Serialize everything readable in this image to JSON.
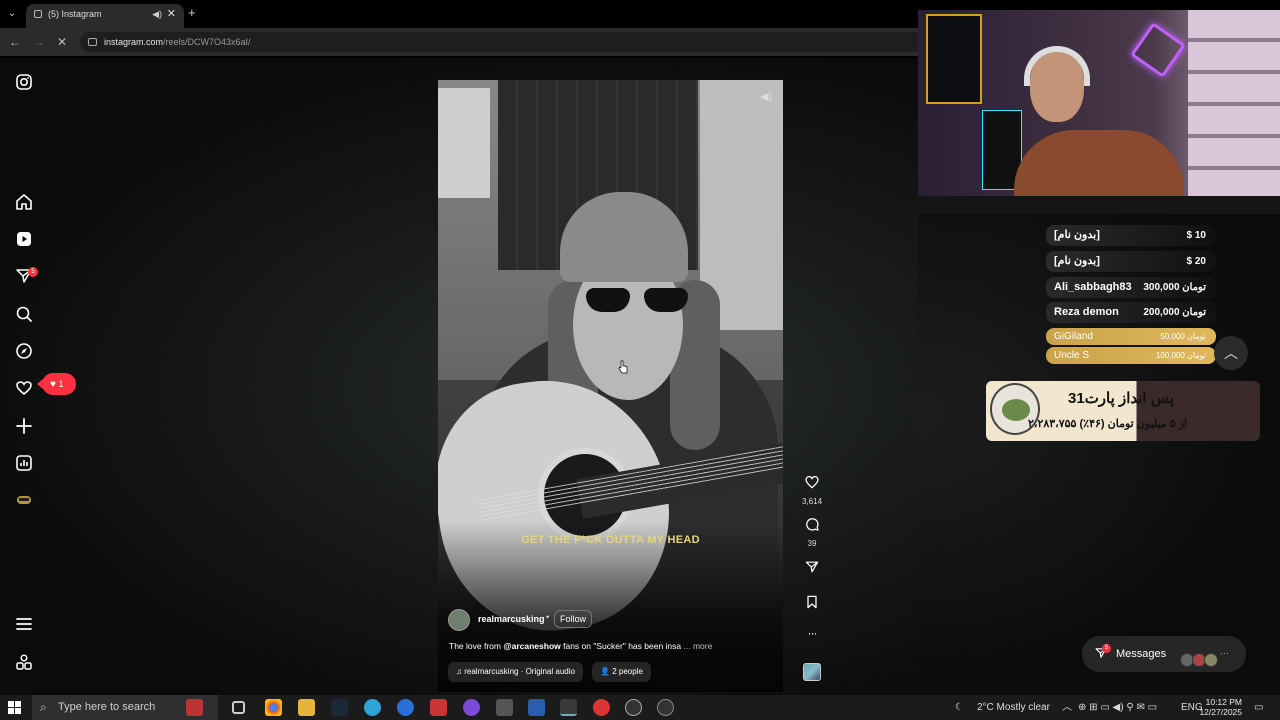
{
  "browser": {
    "tab_title": "(5) Instagram",
    "tab_close": "✕",
    "new_tab": "+",
    "url_site": "instagram.com",
    "url_path": "/reels/DCW7O43x6aI/"
  },
  "sidebar": {
    "notification_count": "5",
    "like_count": "1"
  },
  "reel": {
    "caption_overlay": "GET THE F*CK OUTTA MY HEAD",
    "author": "realmarcusking",
    "separator": "•",
    "follow_label": "Follow",
    "description_pre": "The love from ",
    "description_mention": "@arcaneshow",
    "description_post": " fans on \"Sucker\" has been insa",
    "description_more": "... more",
    "audio_label": "realmarcusking · Original audio",
    "people_label": "2 people",
    "likes": "3,614",
    "comments": "39"
  },
  "donations": [
    {
      "name": "[بدون نام]",
      "amount": "$ 10"
    },
    {
      "name": "[بدون نام]",
      "amount": "$ 20"
    },
    {
      "name": "Ali_sabbagh83",
      "amount": "300,000 تومان"
    },
    {
      "name": "Reza demon",
      "amount": "200,000 تومان"
    },
    {
      "name": "GiGiland",
      "amount": "50,000 تومان"
    },
    {
      "name": "Uncle S",
      "amount": "100,000 تومان"
    }
  ],
  "goal": {
    "title": "پس انداز پارت31",
    "progress_text": "۲،۲۸۳،۷۵۵ از ۵ میلیون تومان (۴۶٪)"
  },
  "messages": {
    "label": "Messages",
    "badge": "5"
  },
  "taskbar": {
    "search_placeholder": "Type here to search",
    "weather": "2°C  Mostly clear",
    "lang": "ENG",
    "time": "10:12 PM",
    "date": "12/27/2025"
  },
  "colors": {
    "instagram_red": "#ff3040",
    "caption_yellow": "#e6d47a",
    "donation_gold": "#caa34a"
  }
}
